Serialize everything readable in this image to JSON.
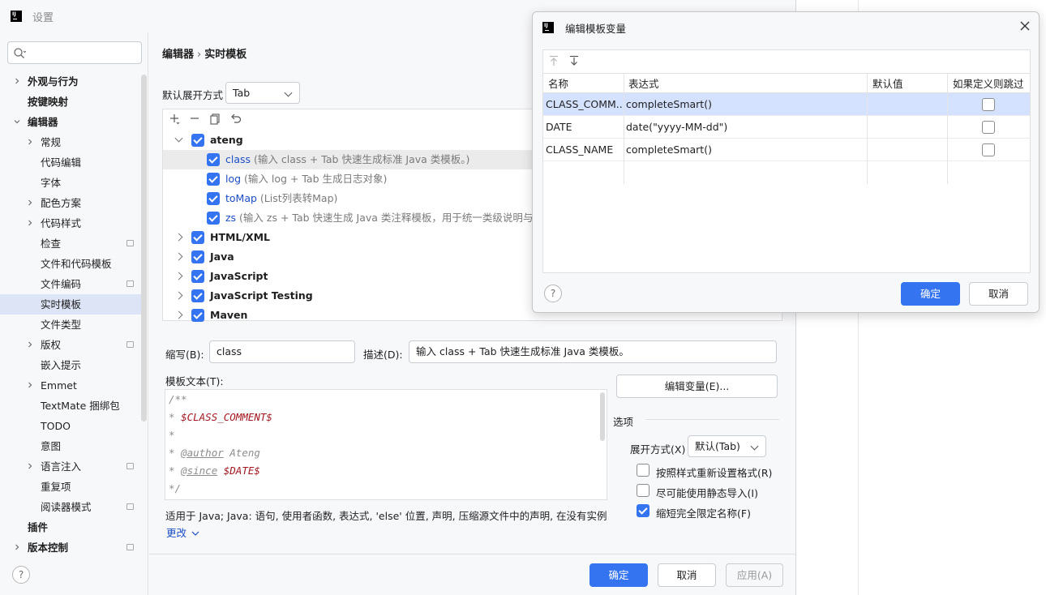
{
  "window": {
    "title": "设置"
  },
  "sidebar": {
    "search_placeholder": "",
    "items": [
      {
        "label": "外观与行为",
        "indent": 0,
        "chevron": "right",
        "bold": true
      },
      {
        "label": "按键映射",
        "indent": 0,
        "chevron": "",
        "bold": true
      },
      {
        "label": "编辑器",
        "indent": 0,
        "chevron": "down",
        "bold": true
      },
      {
        "label": "常规",
        "indent": 1,
        "chevron": "right"
      },
      {
        "label": "代码编辑",
        "indent": 1,
        "chevron": ""
      },
      {
        "label": "字体",
        "indent": 1,
        "chevron": ""
      },
      {
        "label": "配色方案",
        "indent": 1,
        "chevron": "right"
      },
      {
        "label": "代码样式",
        "indent": 1,
        "chevron": "right"
      },
      {
        "label": "检查",
        "indent": 1,
        "chevron": "",
        "lock": true
      },
      {
        "label": "文件和代码模板",
        "indent": 1,
        "chevron": ""
      },
      {
        "label": "文件编码",
        "indent": 1,
        "chevron": "",
        "lock": true
      },
      {
        "label": "实时模板",
        "indent": 1,
        "chevron": "",
        "selected": true
      },
      {
        "label": "文件类型",
        "indent": 1,
        "chevron": ""
      },
      {
        "label": "版权",
        "indent": 1,
        "chevron": "right",
        "lock": true
      },
      {
        "label": "嵌入提示",
        "indent": 1,
        "chevron": ""
      },
      {
        "label": "Emmet",
        "indent": 1,
        "chevron": "right"
      },
      {
        "label": "TextMate 捆绑包",
        "indent": 1,
        "chevron": ""
      },
      {
        "label": "TODO",
        "indent": 1,
        "chevron": ""
      },
      {
        "label": "意图",
        "indent": 1,
        "chevron": ""
      },
      {
        "label": "语言注入",
        "indent": 1,
        "chevron": "right",
        "lock": true
      },
      {
        "label": "重复项",
        "indent": 1,
        "chevron": ""
      },
      {
        "label": "阅读器模式",
        "indent": 1,
        "chevron": "",
        "lock": true
      },
      {
        "label": "插件",
        "indent": 0,
        "chevron": "",
        "bold": true
      },
      {
        "label": "版本控制",
        "indent": 0,
        "chevron": "right",
        "bold": true,
        "lock": true
      }
    ]
  },
  "breadcrumb": {
    "parent": "编辑器",
    "separator": "›",
    "current": "实时模板"
  },
  "expand": {
    "label": "默认展开方式",
    "value": "Tab"
  },
  "templates": [
    {
      "type": "group",
      "name": "ateng",
      "expanded": true,
      "checked": true
    },
    {
      "type": "item",
      "abbr": "class",
      "desc": " (输入 class + Tab 快速生成标准 Java 类模板。)",
      "checked": true,
      "selected": true
    },
    {
      "type": "item",
      "abbr": "log",
      "desc": " (输入 log + Tab 生成日志对象)",
      "checked": true
    },
    {
      "type": "item",
      "abbr": "toMap",
      "desc": " (List列表转Map)",
      "checked": true
    },
    {
      "type": "item",
      "abbr": "zs",
      "desc": " (输入 zs + Tab 快速生成 Java 类注释模板，用于统一类级说明与作",
      "checked": true
    },
    {
      "type": "group",
      "name": "HTML/XML",
      "expanded": false,
      "checked": true
    },
    {
      "type": "group",
      "name": "Java",
      "expanded": false,
      "checked": true
    },
    {
      "type": "group",
      "name": "JavaScript",
      "expanded": false,
      "checked": true
    },
    {
      "type": "group",
      "name": "JavaScript Testing",
      "expanded": false,
      "checked": true
    },
    {
      "type": "group",
      "name": "Maven",
      "expanded": false,
      "checked": true
    }
  ],
  "form": {
    "abbr_label": "缩写(B):",
    "abbr_value": "class",
    "desc_label": "描述(D):",
    "desc_value": "输入 class + Tab 快速生成标准 Java 类模板。",
    "text_label": "模板文本(T):",
    "edit_vars_button": "编辑变量(E)...",
    "code": [
      {
        "a": "/**",
        "b": "",
        "c": ""
      },
      {
        "a": "* ",
        "b": "",
        "c": "$CLASS_COMMENT$"
      },
      {
        "a": "*",
        "b": "",
        "c": ""
      },
      {
        "a": "* ",
        "b": "@author",
        "c": " Ateng"
      },
      {
        "a": "* ",
        "b": "@since",
        "c": " $DATE$"
      },
      {
        "a": "*/",
        "b": "",
        "c": ""
      }
    ],
    "applies_to": "适用于 Java; Java: 语句, 使用者函数, 表达式, 'else' 位置, 声明, 压缩源文件中的声明, 在没有实例 'm...",
    "change_link": "更改"
  },
  "options": {
    "header": "选项",
    "expand_with_label": "展开方式(X)",
    "expand_with_value": "默认(Tab)",
    "reformat": {
      "label": "按照样式重新设置格式(R)",
      "checked": false
    },
    "static_import": {
      "label": "尽可能使用静态导入(I)",
      "checked": false
    },
    "shorten_fq": {
      "label": "缩短完全限定名称(F)",
      "checked": true
    }
  },
  "footer": {
    "ok": "确定",
    "cancel": "取消",
    "apply": "应用(A)"
  },
  "dialog": {
    "title": "编辑模板变量",
    "columns": [
      "名称",
      "表达式",
      "默认值",
      "如果定义则跳过"
    ],
    "rows": [
      {
        "name": "CLASS_COMM...",
        "expr": "completeSmart()",
        "default": "",
        "skip": false,
        "selected": true
      },
      {
        "name": "DATE",
        "expr": "date(\"yyyy-MM-dd\")",
        "default": "",
        "skip": false
      },
      {
        "name": "CLASS_NAME",
        "expr": "completeSmart()",
        "default": "",
        "skip": false
      }
    ],
    "ok": "确定",
    "cancel": "取消"
  },
  "colors": {
    "accent": "#3574f0",
    "selection": "#dce4f5",
    "link": "#1a4dc5",
    "variable": "#a3171f"
  }
}
